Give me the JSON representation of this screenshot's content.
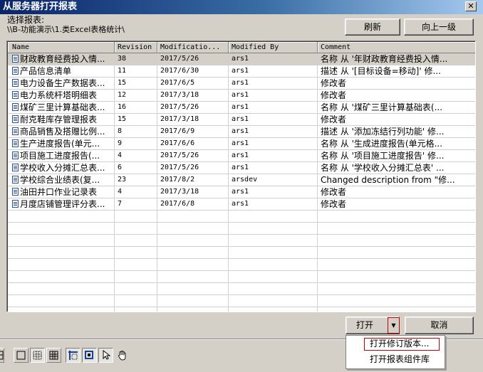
{
  "window": {
    "title": "从服务器打开报表",
    "close": "✕"
  },
  "path": {
    "label": "选择报表:",
    "value": "\\\\B-功能演示\\1.类Excel表格统计\\"
  },
  "toolbar": {
    "refresh_label": "刷新",
    "up_label": "向上一级"
  },
  "columns": [
    "Name",
    "Revision",
    "Modificatio...",
    "Modified By",
    "Comment"
  ],
  "rows": [
    {
      "name": "财政教育经费投入情...",
      "revision": "38",
      "modified": "2017/5/26",
      "by": "ars1",
      "comment": "名称 从 '年财政教育经费投入情..."
    },
    {
      "name": "产品信息清单",
      "revision": "11",
      "modified": "2017/6/30",
      "by": "ars1",
      "comment": "描述 从 '[目标设备=移动]' 修..."
    },
    {
      "name": "电力设备生产数据表...",
      "revision": "15",
      "modified": "2017/6/5",
      "by": "ars1",
      "comment": "修改者"
    },
    {
      "name": "电力系统杆塔明细表",
      "revision": "12",
      "modified": "2017/3/18",
      "by": "ars1",
      "comment": "修改者"
    },
    {
      "name": "煤矿三里计算基础表...",
      "revision": "16",
      "modified": "2017/5/26",
      "by": "ars1",
      "comment": "名称 从 '煤矿三里计算基础表(..."
    },
    {
      "name": "耐克鞋库存管理报表",
      "revision": "15",
      "modified": "2017/3/18",
      "by": "ars1",
      "comment": "修改者"
    },
    {
      "name": "商品销售及搭赠比例...",
      "revision": "8",
      "modified": "2017/6/9",
      "by": "ars1",
      "comment": "描述 从 '添加冻结行列功能' 修..."
    },
    {
      "name": "生产进度报告(单元...",
      "revision": "9",
      "modified": "2017/6/6",
      "by": "ars1",
      "comment": "名称 从 '生成进度报告(单元格..."
    },
    {
      "name": "项目施工进度报告(...",
      "revision": "4",
      "modified": "2017/5/26",
      "by": "ars1",
      "comment": "名称 从 '项目施工进度报告' 修..."
    },
    {
      "name": "学校收入分摊汇总表...",
      "revision": "6",
      "modified": "2017/5/26",
      "by": "ars1",
      "comment": "名称 从 '学校收入分摊汇总表' ..."
    },
    {
      "name": "学校综合业绩表(复...",
      "revision": "23",
      "modified": "2017/8/2",
      "by": "arsdev",
      "comment": "Changed description from \"修..."
    },
    {
      "name": "油田井口作业记录表",
      "revision": "4",
      "modified": "2017/3/18",
      "by": "ars1",
      "comment": "修改者"
    },
    {
      "name": "月度店铺管理评分表...",
      "revision": "7",
      "modified": "2017/6/8",
      "by": "ars1",
      "comment": "修改者"
    }
  ],
  "footer": {
    "open_label": "打开",
    "split_arrow": "▼",
    "cancel_label": "取消"
  },
  "menu": {
    "open_revision": "打开修订版本...",
    "open_component": "打开报表组件库"
  },
  "colors": {
    "title_start": "#0a246a",
    "title_end": "#a6caf0",
    "highlight": "#c00000",
    "face": "#d4d0c8"
  }
}
